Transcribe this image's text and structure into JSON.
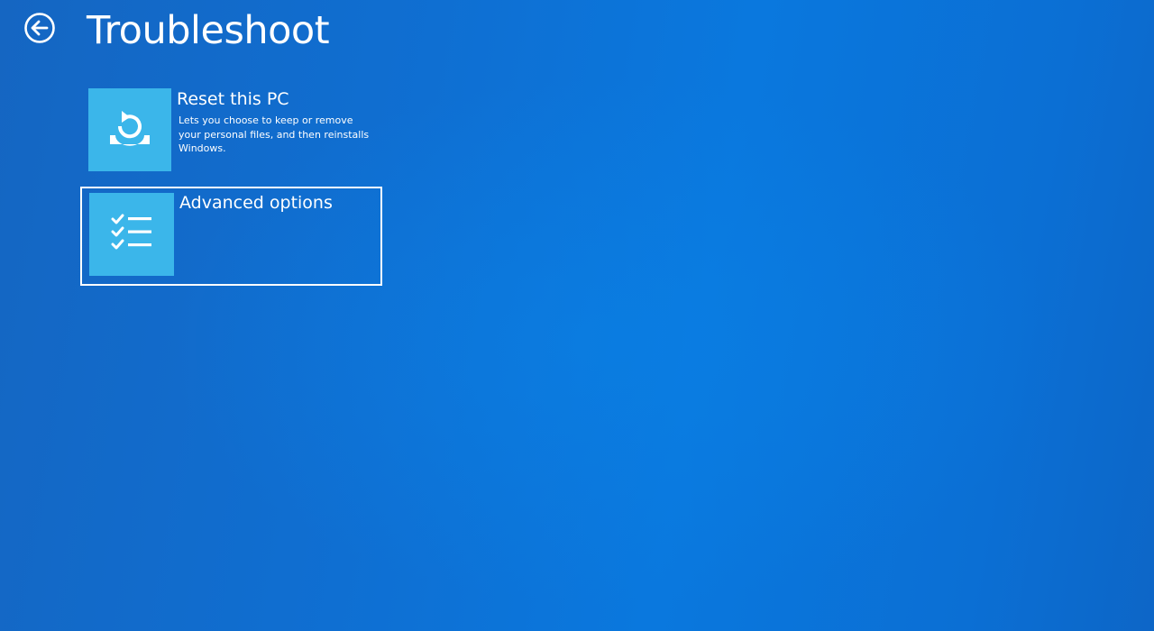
{
  "page": {
    "title": "Troubleshoot",
    "back_icon": "back-arrow-circle-icon"
  },
  "colors": {
    "background": "#0f6fd2",
    "tile": "#3bb6ea",
    "text": "#ffffff",
    "selection_border": "#ffffff"
  },
  "options": [
    {
      "label": "Reset this PC",
      "description": "Lets you choose to keep or remove your personal files, and then reinstalls Windows.",
      "icon": "reset-pc-icon",
      "selected": false
    },
    {
      "label": "Advanced options",
      "description": "",
      "icon": "checklist-icon",
      "selected": true
    }
  ]
}
